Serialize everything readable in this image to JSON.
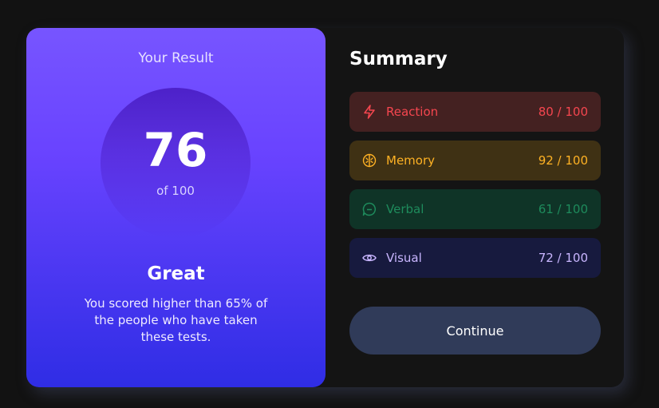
{
  "result": {
    "title": "Your Result",
    "score": "76",
    "of_label": "of 100",
    "grade": "Great",
    "description": "You scored higher than 65% of the people who have taken these tests."
  },
  "summary": {
    "title": "Summary",
    "items": [
      {
        "label": "Reaction",
        "score": "80 / 100",
        "icon": "lightning-icon",
        "color": "#f5464f",
        "bg": "#442121"
      },
      {
        "label": "Memory",
        "score": "92 / 100",
        "icon": "brain-icon",
        "color": "#ffb224",
        "bg": "#3f3114"
      },
      {
        "label": "Verbal",
        "score": "61 / 100",
        "icon": "chat-bubble-icon",
        "color": "#1e8b5c",
        "bg": "#0f3427"
      },
      {
        "label": "Visual",
        "score": "72 / 100",
        "icon": "eye-icon",
        "color": "#c9b6ff",
        "bg": "#171a3e"
      }
    ],
    "continue_label": "Continue"
  }
}
